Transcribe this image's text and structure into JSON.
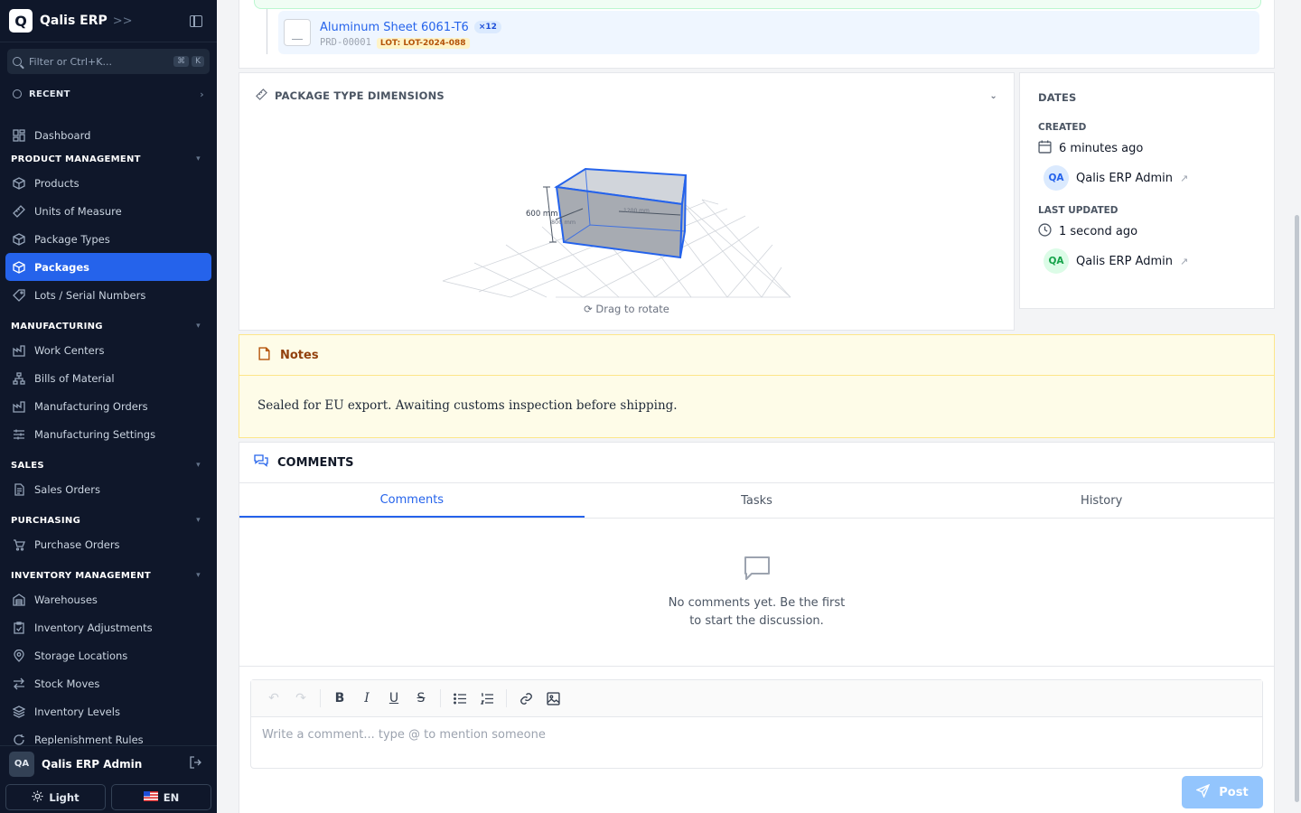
{
  "app": {
    "logo_letter": "Q",
    "name": "Qalis ERP"
  },
  "search": {
    "placeholder": "Filter or Ctrl+K...",
    "kbd1": "⌘",
    "kbd2": "K"
  },
  "recent": {
    "label": "RECENT"
  },
  "nav": {
    "dashboard": "Dashboard",
    "sec_product": "PRODUCT MANAGEMENT",
    "products": "Products",
    "uom": "Units of Measure",
    "package_types": "Package Types",
    "packages": "Packages",
    "lots": "Lots / Serial Numbers",
    "sec_manufacturing": "MANUFACTURING",
    "work_centers": "Work Centers",
    "bom": "Bills of Material",
    "mo": "Manufacturing Orders",
    "mfg_settings": "Manufacturing Settings",
    "sec_sales": "SALES",
    "sales_orders": "Sales Orders",
    "sec_purchasing": "PURCHASING",
    "purchase_orders": "Purchase Orders",
    "sec_inventory": "INVENTORY MANAGEMENT",
    "warehouses": "Warehouses",
    "inv_adj": "Inventory Adjustments",
    "storage": "Storage Locations",
    "stock_moves": "Stock Moves",
    "inv_levels": "Inventory Levels",
    "replenish": "Replenishment Rules"
  },
  "footer": {
    "initials": "QA",
    "user": "Qalis ERP Admin",
    "theme": "Light",
    "lang": "EN"
  },
  "product": {
    "name": "Aluminum Sheet 6061-T6",
    "qty": "×12",
    "code": "PRD-00001",
    "lot": "LOT: LOT-2024-088"
  },
  "dimensions": {
    "title": "PACKAGE TYPE DIMENSIONS",
    "height_label": "600 mm",
    "depth_label": "800 mm",
    "width_label": "1200 mm",
    "drag_hint": "Drag to rotate"
  },
  "dates": {
    "title": "DATES",
    "created_label": "CREATED",
    "created_val": "6 minutes ago",
    "created_by": "Qalis ERP Admin",
    "created_initials": "QA",
    "updated_label": "LAST UPDATED",
    "updated_val": "1 second ago",
    "updated_by": "Qalis ERP Admin",
    "updated_initials": "QA"
  },
  "notes": {
    "title": "Notes",
    "body": "Sealed for EU export. Awaiting customs inspection before shipping."
  },
  "comments": {
    "title": "COMMENTS",
    "tabs": [
      "Comments",
      "Tasks",
      "History"
    ],
    "empty": "No comments yet. Be the first to start the discussion.",
    "placeholder": "Write a comment... type @ to mention someone",
    "post": "Post"
  },
  "colors": {
    "accent": "#2563eb",
    "sidebar": "#0f172a",
    "notes_bg": "#fefce8"
  }
}
